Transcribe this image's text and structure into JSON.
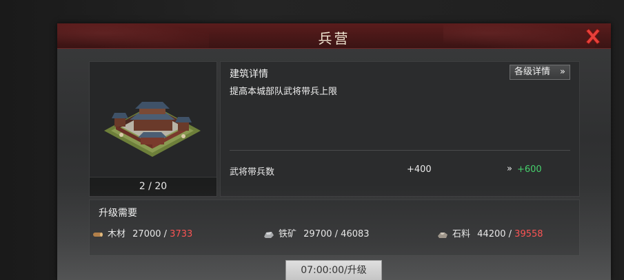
{
  "dialog": {
    "title": "兵营",
    "close_icon": "close-x-icon",
    "accent_color": "#5a1c1c"
  },
  "building": {
    "image": "barracks-building-image",
    "level_text": "2 / 20"
  },
  "details": {
    "title": "建筑详情",
    "all_levels_button": "各级详情",
    "all_levels_icon": "double-chevron-right-icon",
    "description": "提高本城部队武将带兵上限",
    "stat": {
      "label": "武将带兵数",
      "current": "+400",
      "arrow": "»",
      "next": "+600",
      "next_color": "#46d06c"
    }
  },
  "requirements": {
    "title": "升级需要",
    "lack_color": "#ff4b4b",
    "items": [
      {
        "icon": "wood-icon",
        "name": "木材",
        "need": "27000",
        "sep": " / ",
        "have": "3733",
        "sufficient": false
      },
      {
        "icon": "iron-ore-icon",
        "name": "铁矿",
        "need": "29700",
        "sep": " / ",
        "have": "46083",
        "sufficient": true
      },
      {
        "icon": "stone-icon",
        "name": "石料",
        "need": "44200",
        "sep": " / ",
        "have": "39558",
        "sufficient": false
      }
    ]
  },
  "upgrade_button": "07:00:00/升级"
}
